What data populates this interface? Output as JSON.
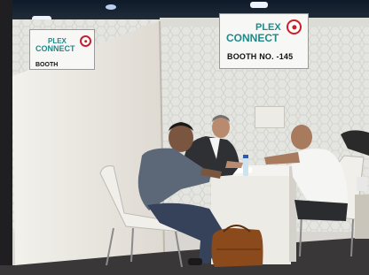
{
  "scene": {
    "kind": "photo",
    "description_free": true
  },
  "signs": {
    "left": {
      "brand_line1": "PLEX",
      "brand_line2": "CONNECT",
      "booth_text": "BOOTH"
    },
    "right": {
      "brand_line1": "PLEX",
      "brand_line2": "CONNECT",
      "booth_text": "BOOTH NO. -145"
    }
  },
  "colors": {
    "brand_teal": "#1e8a8a",
    "logo_red": "#c8202a",
    "wall": "#e3e3df",
    "carpet": "#3a3838"
  }
}
